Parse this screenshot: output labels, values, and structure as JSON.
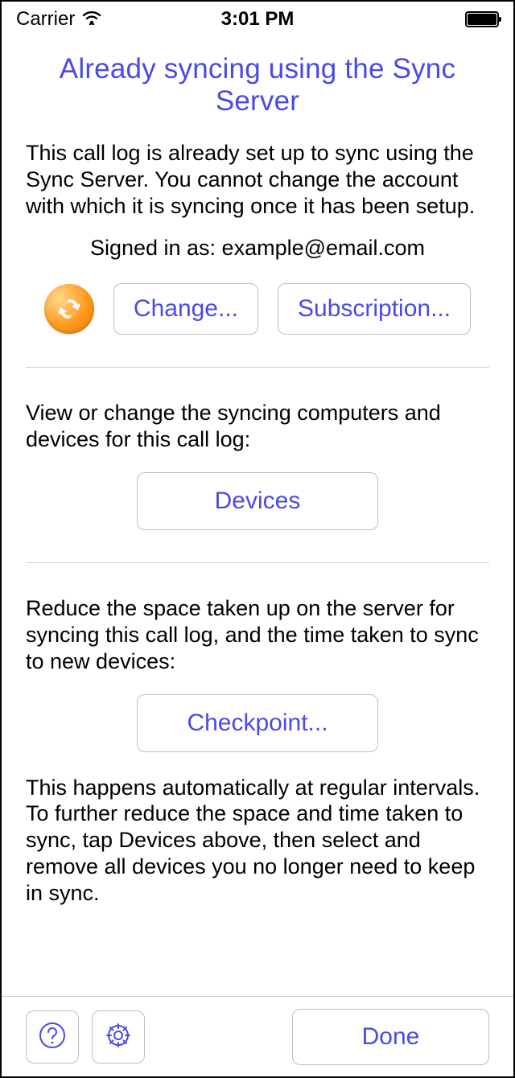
{
  "status_bar": {
    "carrier": "Carrier",
    "time": "3:01 PM"
  },
  "title": "Already syncing using the Sync Server",
  "intro_text": "This call log is already set up to sync using the Sync Server. You cannot change the account with which it is syncing once it has been setup.",
  "signed_in_label": "Signed in as: ",
  "signed_in_email": "example@email.com",
  "buttons": {
    "change": "Change...",
    "subscription": "Subscription...",
    "devices": "Devices",
    "checkpoint": "Checkpoint...",
    "done": "Done"
  },
  "devices_text": "View or change the syncing computers and devices for this call log:",
  "checkpoint_text": "Reduce the space taken up on the server for syncing this call log, and the time taken to sync to new devices:",
  "checkpoint_after_text": "This happens automatically at regular intervals. To further reduce the space and time taken to sync, tap Devices above, then select and remove all devices you no longer need to keep in sync.",
  "colors": {
    "accent": "#4a4ae6"
  }
}
